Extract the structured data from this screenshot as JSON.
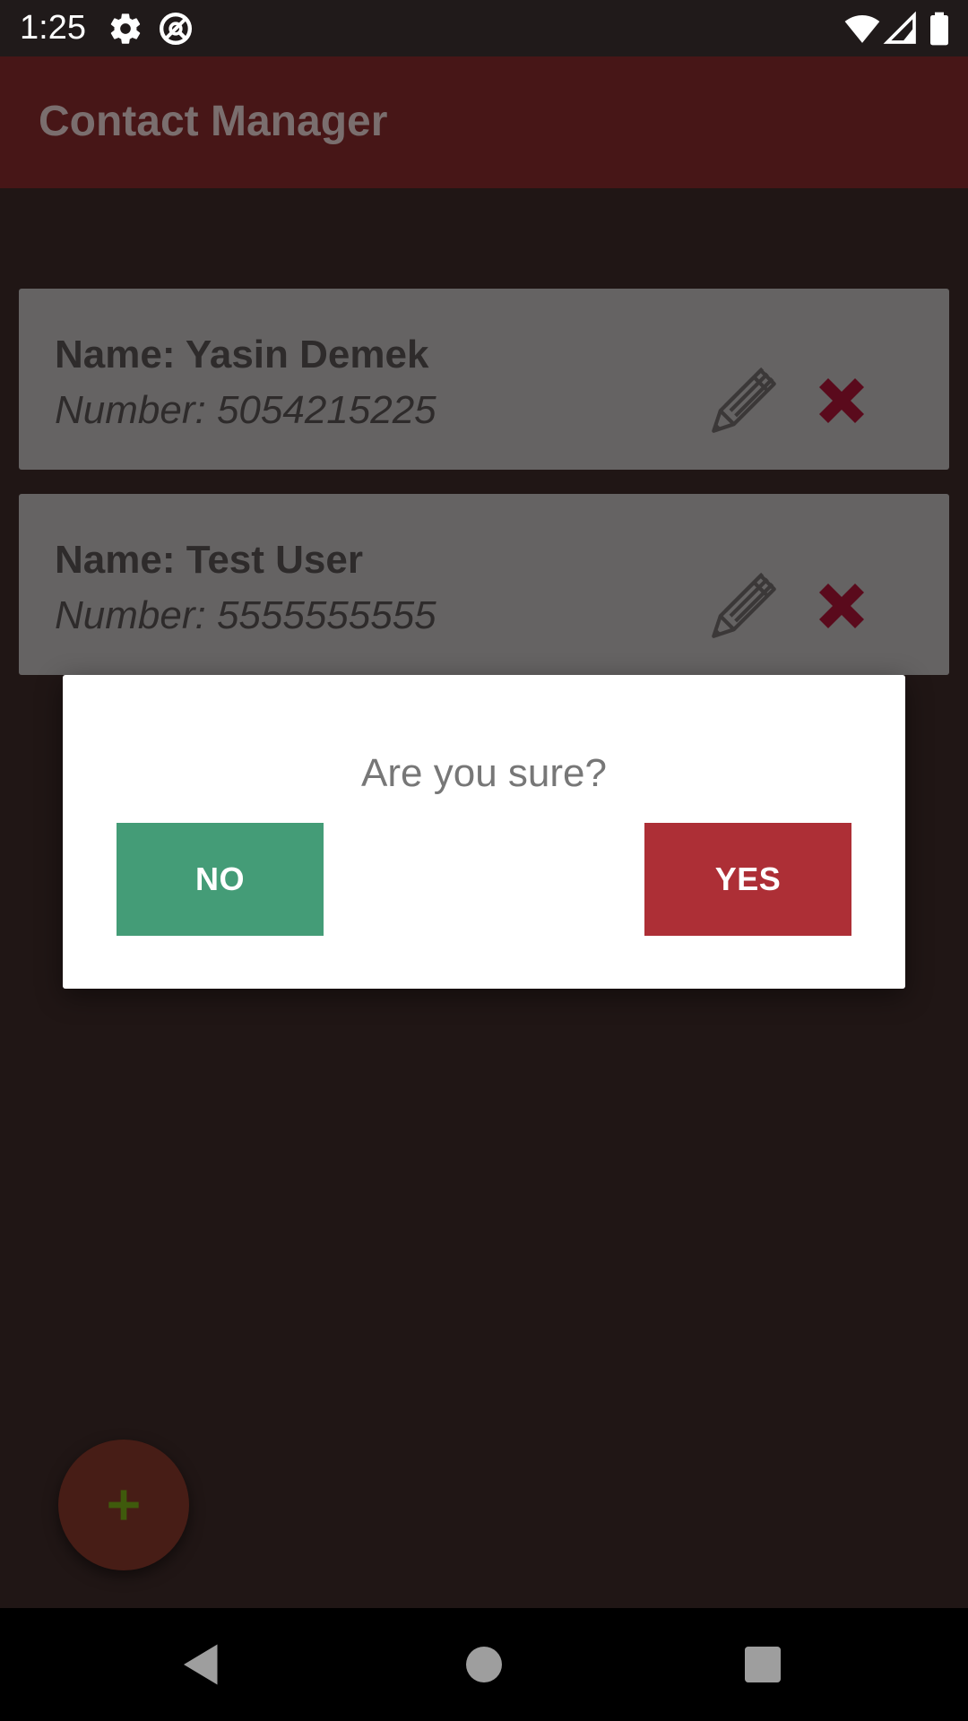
{
  "status_bar": {
    "time": "1:25",
    "icons": [
      "settings-icon",
      "do-not-disturb-icon",
      "wifi-icon",
      "signal-icon",
      "battery-icon"
    ]
  },
  "app_bar": {
    "title": "Contact Manager",
    "color": "#471617"
  },
  "contacts": [
    {
      "name": "Name: Yasin Demek",
      "number": "Number: 5054215225"
    },
    {
      "name": "Name: Test User",
      "number": "Number: 5555555555"
    }
  ],
  "dialog": {
    "message": "Are you sure?",
    "no_label": "NO",
    "yes_label": "YES",
    "no_color": "#449c77",
    "yes_color": "#ad2f36"
  },
  "fab": {
    "icon": "plus-icon"
  },
  "nav_bar": {
    "icons": [
      "back-icon",
      "home-icon",
      "recents-icon"
    ]
  }
}
